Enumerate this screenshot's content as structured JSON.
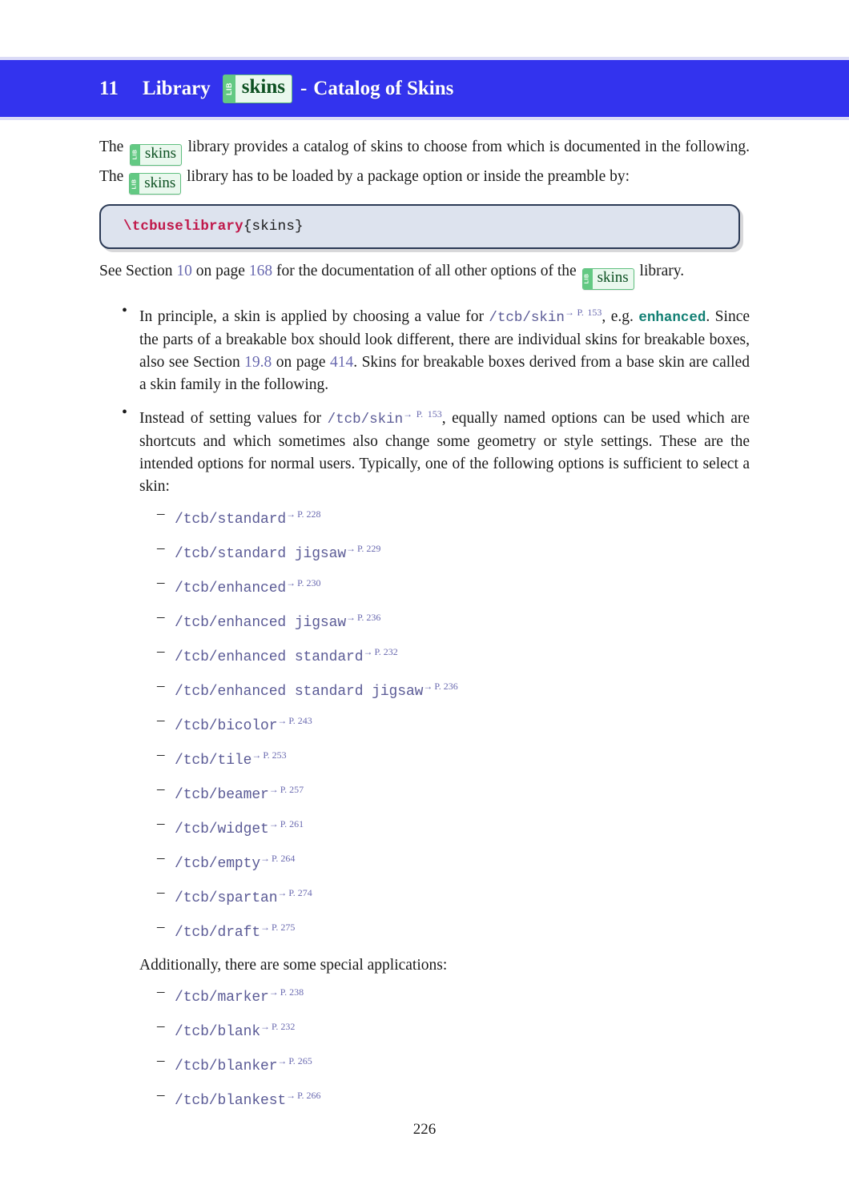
{
  "header": {
    "number": "11",
    "word_library": "Library",
    "badge": {
      "tab": "LIB",
      "name": "skins"
    },
    "dash": "-",
    "rest": "Catalog of Skins"
  },
  "intro": {
    "part1": "The",
    "badge1": {
      "tab": "LIB",
      "name": "skins"
    },
    "part2": "library provides a catalog of skins to choose from which is documented in the following. The",
    "badge2": {
      "tab": "LIB",
      "name": "skins"
    },
    "part3": "library has to be loaded by a package option or inside the preamble by:"
  },
  "code_box": {
    "command": "\\tcbuselibrary",
    "argument": "{skins}"
  },
  "see_section": {
    "part1": "See Section",
    "section_link": "10",
    "part2": "on page",
    "page_link": "168",
    "part3": "for the documentation of all other options of the",
    "badge": {
      "tab": "LIB",
      "name": "skins"
    },
    "part4": "library."
  },
  "bullets": [
    {
      "segments": [
        {
          "type": "text",
          "value": "In principle, a skin is applied by choosing a value for "
        },
        {
          "type": "mono",
          "value": "/tcb/skin"
        },
        {
          "type": "pageref",
          "value": "P. 153"
        },
        {
          "type": "text",
          "value": ", e.g. "
        },
        {
          "type": "mono-teal",
          "value": "enhanced"
        },
        {
          "type": "text",
          "value": ". Since the parts of a breakable box should look different, there are individual skins for breakable boxes, also see Section "
        },
        {
          "type": "link",
          "value": "19.8"
        },
        {
          "type": "text",
          "value": " on page "
        },
        {
          "type": "link",
          "value": "414"
        },
        {
          "type": "text",
          "value": ". Skins for breakable boxes derived from a base skin are called a skin family in the following."
        }
      ]
    },
    {
      "segments": [
        {
          "type": "text",
          "value": "Instead of setting values for "
        },
        {
          "type": "mono",
          "value": "/tcb/skin"
        },
        {
          "type": "pageref",
          "value": "P. 153"
        },
        {
          "type": "text",
          "value": ", equally named options can be used which are shortcuts and which sometimes also change some geometry or style settings. These are the intended options for normal users. Typically, one of the following options is sufficient to select a skin:"
        }
      ]
    }
  ],
  "skin_options": [
    {
      "name": "/tcb/standard",
      "page": "P. 228"
    },
    {
      "name": "/tcb/standard jigsaw",
      "page": "P. 229"
    },
    {
      "name": "/tcb/enhanced",
      "page": "P. 230"
    },
    {
      "name": "/tcb/enhanced jigsaw",
      "page": "P. 236"
    },
    {
      "name": "/tcb/enhanced standard",
      "page": "P. 232"
    },
    {
      "name": "/tcb/enhanced standard jigsaw",
      "page": "P. 236"
    },
    {
      "name": "/tcb/bicolor",
      "page": "P. 243"
    },
    {
      "name": "/tcb/tile",
      "page": "P. 253"
    },
    {
      "name": "/tcb/beamer",
      "page": "P. 257"
    },
    {
      "name": "/tcb/widget",
      "page": "P. 261"
    },
    {
      "name": "/tcb/empty",
      "page": "P. 264"
    },
    {
      "name": "/tcb/spartan",
      "page": "P. 274"
    },
    {
      "name": "/tcb/draft",
      "page": "P. 275"
    }
  ],
  "additionally_text": "Additionally, there are some special applications:",
  "special_options": [
    {
      "name": "/tcb/marker",
      "page": "P. 238"
    },
    {
      "name": "/tcb/blank",
      "page": "P. 232"
    },
    {
      "name": "/tcb/blanker",
      "page": "P. 265"
    },
    {
      "name": "/tcb/blankest",
      "page": "P. 266"
    }
  ],
  "footer": {
    "page_number": "226"
  },
  "colors": {
    "band": "#3333ee",
    "badge_tab": "#63c983",
    "badge_bg": "#eaf8ee",
    "badge_text": "#0b4f20",
    "link": "#6a6ab0",
    "mono": "#5b5b96",
    "teal": "#117f73",
    "code_cmd": "#c0184a",
    "code_bg": "#dde3ee",
    "code_border": "#2b3a55"
  }
}
